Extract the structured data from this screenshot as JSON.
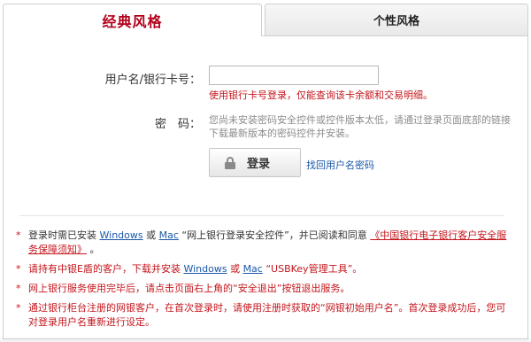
{
  "tabs": {
    "classic": "经典风格",
    "personal": "个性风格"
  },
  "form": {
    "username_label": "用户名/银行卡号：",
    "username_value": "",
    "card_login_tip": "使用银行卡号登录，仅能查询该卡余额和交易明细。",
    "password_label": "密　码：",
    "password_tip": "您尚未安装密码安全控件或控件版本太低，请通过登录页面底部的链接下载最新版本的密码控件并安装。",
    "login_button": "登录",
    "recover_link": "找回用户名密码"
  },
  "notes": [
    {
      "star": "*",
      "p1": "登录时需已安装",
      "link1": "Windows",
      "p2": "或",
      "link2": "Mac",
      "p3": "“网上银行登录安全控件”，并已阅读和同意",
      "link3": "《中国银行电子银行客户安全服务保障须知》",
      "p4": "。"
    },
    {
      "star": "*",
      "p1": "请持有中银E盾的客户，下载并安装",
      "link1": "Windows",
      "p2": "或",
      "link2": "Mac",
      "p3": "“USBKey管理工具”。"
    },
    {
      "star": "*",
      "text": "网上银行服务使用完毕后，请点击页面右上角的“安全退出”按钮退出服务。"
    },
    {
      "star": "*",
      "text": "通过银行柜台注册的网银客户，在首次登录时，请使用注册时获取的“网银初始用户名”。首次登录成功后，您可对登录用户名重新进行设定。"
    }
  ],
  "colors": {
    "accent_red": "#b3001b",
    "link_blue": "#1a58a8",
    "tip_gray": "#8c8c8c"
  },
  "icons": {
    "login_button_icon": "lock-icon"
  }
}
